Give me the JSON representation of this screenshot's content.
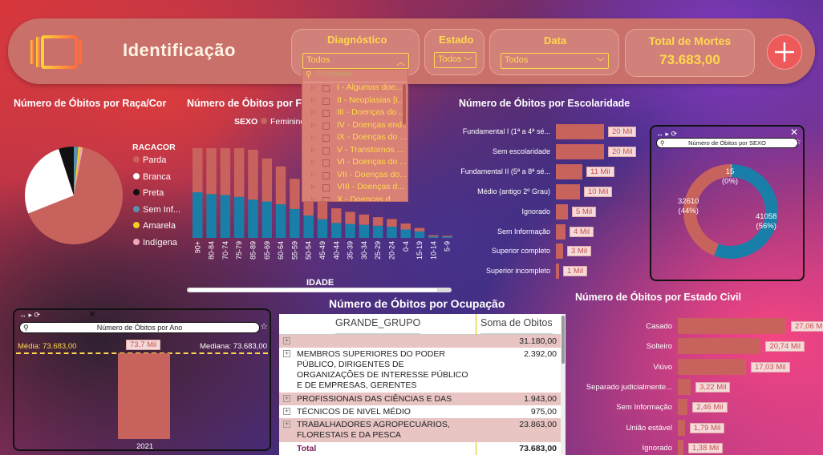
{
  "header": {
    "title": "Identificação",
    "filters": [
      {
        "label": "Diagnóstico",
        "value": "Todos"
      },
      {
        "label": "Estado",
        "value": "Todos"
      },
      {
        "label": "Data",
        "value": "Todos"
      }
    ],
    "total_label": "Total de Mortes",
    "total_value": "73.683,00"
  },
  "diagnostico_dropdown": {
    "placeholder": "Pesquisar",
    "items": [
      "I - Algumas doe...",
      "II - Neoplasias [t...",
      "III - Doenças do ...",
      "IV - Doenças end...",
      "IX - Doenças do ...",
      "V - Transtornos ...",
      "VI - Doenças do ...",
      "VII - Doenças do...",
      "VIII - Doenças d...",
      "X - Doenças d..."
    ]
  },
  "raca": {
    "title": "Número de Óbitos por Raça/Cor",
    "legend_title": "RACACOR",
    "colors": {
      "Parda": "#c8625c",
      "Branca": "#ffffff",
      "Preta": "#111111",
      "Sem Inf...": "#5b8fb0",
      "Amarela": "#f0d020",
      "Indígena": "#f2a7b8"
    },
    "chart_data": {
      "type": "pie",
      "labels": [
        "Parda",
        "Branca",
        "Preta",
        "Sem Inf...",
        "Amarela",
        "Indígena"
      ],
      "values": [
        66,
        26,
        5,
        1.5,
        0.8,
        0.7
      ]
    }
  },
  "faixa": {
    "title": "Número de Óbitos por F",
    "legend_title": "SEXO",
    "legend_item": "Feminino",
    "xlabel": "IDADE",
    "colors": {
      "fem": "#c8625c",
      "masc": "#1a7fa8"
    },
    "chart_data": {
      "type": "bar",
      "categories": [
        "90+",
        "80-84",
        "70-74",
        "75-79",
        "85-89",
        "65-69",
        "60-64",
        "55-59",
        "50-54",
        "45-49",
        "40-44",
        "35-39",
        "30-34",
        "25-29",
        "20-24",
        "0-4",
        "15-19",
        "10-14",
        "5-9"
      ],
      "series": [
        {
          "name": "Feminino",
          "values": [
            6900,
            6500,
            6300,
            6000,
            5800,
            5000,
            4400,
            3500,
            2700,
            2100,
            1700,
            1400,
            1200,
            1000,
            900,
            700,
            400,
            150,
            120
          ]
        },
        {
          "values": [
            4900,
            4700,
            4600,
            4400,
            4100,
            3900,
            3600,
            3100,
            2400,
            2000,
            1600,
            1500,
            1400,
            1300,
            1200,
            900,
            700,
            150,
            120
          ]
        }
      ],
      "ylim": [
        0,
        7500
      ]
    }
  },
  "escolaridade": {
    "title": "Número de Óbitos por Escolaridade",
    "chart_data": {
      "type": "bar",
      "categories": [
        "Fundamental I (1ª a 4ª sé...",
        "Sem escolaridade",
        "Fundamental II (5ª a 8ª sé...",
        "Médio (antigo 2º Grau)",
        "Ignorado",
        "Sem Informação",
        "Superior completo",
        "Superior incompleto"
      ],
      "values": [
        20,
        20,
        11,
        10,
        5,
        4,
        3,
        1
      ],
      "labels": [
        "20 Mil",
        "20 Mil",
        "11 Mil",
        "10 Mil",
        "5 Mil",
        "4 Mil",
        "3 Mil",
        "1 Mil"
      ]
    }
  },
  "sexo_donut": {
    "window_title": "Número de Óbitos por SEXO",
    "colors": {
      "fem": "#c8625c",
      "masc": "#1a7fa8",
      "other": "#f2a7b8"
    },
    "chart_data": {
      "type": "pie",
      "values": [
        41058,
        32610,
        15
      ],
      "labels": [
        "41058\n(56%)",
        "32610\n(44%)",
        "15\n(0%)"
      ]
    },
    "label_masc_1": "41058",
    "label_masc_2": "(56%)",
    "label_fem_1": "32610",
    "label_fem_2": "(44%)",
    "label_other_1": "15",
    "label_other_2": "(0%)"
  },
  "ano": {
    "window_title": "Número de Óbitos por Ano",
    "media": "Média: 73.683,00",
    "mediana": "Mediana: 73.683,00",
    "bar_value": "73,7 Mil",
    "chart_data": {
      "type": "bar",
      "categories": [
        "2021"
      ],
      "values": [
        73683
      ]
    }
  },
  "ocupacao": {
    "title": "Número de Óbitos por Ocupação",
    "columns": [
      "GRANDE_GRUPO",
      "Soma de Obitos"
    ],
    "rows": [
      {
        "name": "",
        "value": "31.180,00"
      },
      {
        "name": "MEMBROS SUPERIORES DO PODER PÚBLICO, DIRIGENTES DE ORGANIZAÇÕES DE INTERESSE PÚBLICO E DE EMPRESAS, GERENTES",
        "value": "2.392,00"
      },
      {
        "name": "PROFISSIONAIS DAS CIÊNCIAS E DAS ARTES",
        "value": "1.943,00"
      },
      {
        "name": "TÉCNICOS DE NIVEL MÉDIO",
        "value": "975,00"
      },
      {
        "name": "TRABALHADORES AGROPECUÁRIOS, FLORESTAIS E DA PESCA",
        "value": "23.863,00"
      }
    ],
    "total_label": "Total",
    "total_value": "73.683,00"
  },
  "estado_civil": {
    "title": "Número de Óbitos por Estado Civil",
    "chart_data": {
      "type": "bar",
      "categories": [
        "Casado",
        "Solteiro",
        "Viúvo",
        "Separado judicialmente...",
        "Sem Informação",
        "União estável",
        "Ignorado"
      ],
      "values": [
        27.06,
        20.74,
        17.03,
        3.22,
        2.46,
        1.79,
        1.38
      ],
      "labels": [
        "27,06 Mil",
        "20,74 Mil",
        "17,03 Mil",
        "3,22 Mil",
        "2,46 Mil",
        "1,79 Mil",
        "1,38 Mil"
      ]
    }
  }
}
